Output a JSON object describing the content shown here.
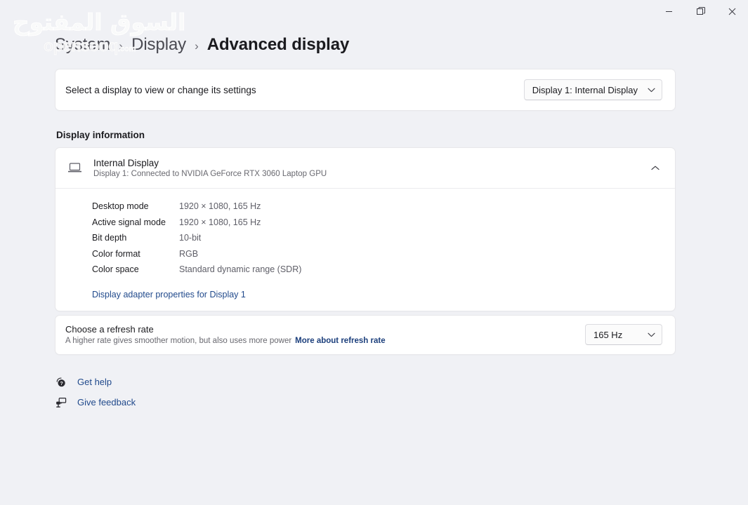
{
  "window": {
    "controls": [
      {
        "name": "minimize",
        "label": "Minimize"
      },
      {
        "name": "restore",
        "label": "Restore"
      },
      {
        "name": "close",
        "label": "Close"
      }
    ]
  },
  "watermark": {
    "arabic": "السوق المفتوح",
    "english": "opensooq",
    "english_suffix": ".com"
  },
  "breadcrumb": {
    "items": [
      {
        "label": "System",
        "current": false
      },
      {
        "label": "Display",
        "current": false
      },
      {
        "label": "Advanced display",
        "current": true
      }
    ],
    "separator": "›"
  },
  "select_display": {
    "label": "Select a display to view or change its settings",
    "dropdown_value": "Display 1: Internal Display",
    "dropdown_icon": "chevron-down-icon"
  },
  "display_information": {
    "section_title": "Display information",
    "monitor": {
      "icon": "laptop-icon",
      "title": "Internal Display",
      "subtitle": "Display 1: Connected to NVIDIA GeForce RTX 3060 Laptop GPU",
      "expander_icon": "chevron-up-icon",
      "expanded": true
    },
    "details": [
      {
        "key": "Desktop mode",
        "value": "1920 × 1080, 165 Hz"
      },
      {
        "key": "Active signal mode",
        "value": "1920 × 1080, 165 Hz"
      },
      {
        "key": "Bit depth",
        "value": "10-bit"
      },
      {
        "key": "Color format",
        "value": "RGB"
      },
      {
        "key": "Color space",
        "value": "Standard dynamic range (SDR)"
      }
    ],
    "adapter_link": "Display adapter properties for Display 1"
  },
  "refresh_rate": {
    "title": "Choose a refresh rate",
    "subtitle": "A higher rate gives smoother motion, but also uses more power",
    "more_link": "More about refresh rate",
    "dropdown_value": "165 Hz",
    "dropdown_icon": "chevron-down-icon"
  },
  "footer": {
    "links": [
      {
        "label": "Get help",
        "icon": "help-question-icon"
      },
      {
        "label": "Give feedback",
        "icon": "feedback-icon"
      }
    ]
  },
  "colors": {
    "page_background": "#f0f1f5",
    "card_background": "#ffffff",
    "card_border": "#e7e7ea",
    "text_primary": "#1b1b1f",
    "text_secondary": "#68686f",
    "link_accent": "#214a8c"
  }
}
